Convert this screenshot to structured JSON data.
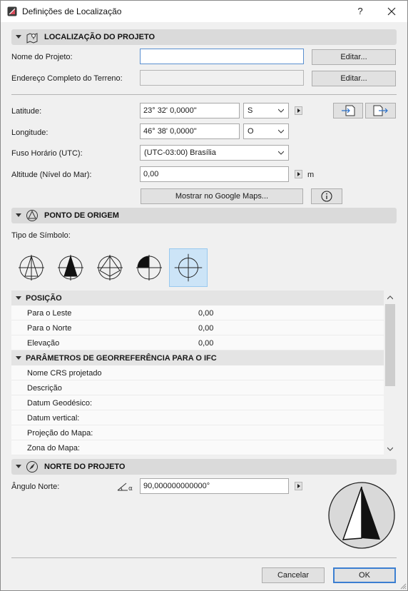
{
  "window": {
    "title": "Definições de Localização",
    "help_label": "?"
  },
  "project_location": {
    "header": "LOCALIZAÇÃO DO PROJETO",
    "project_name_label": "Nome do Projeto:",
    "project_name_value": "",
    "address_label": "Endereço Completo do Terreno:",
    "address_value": "",
    "edit_label": "Editar...",
    "latitude_label": "Latitude:",
    "latitude_value": "23° 32' 0,0000\"",
    "latitude_hemisphere": "S",
    "longitude_label": "Longitude:",
    "longitude_value": "46° 38' 0,0000\"",
    "longitude_hemisphere": "O",
    "timezone_label": "Fuso Horário (UTC):",
    "timezone_value": "(UTC-03:00) Brasília",
    "altitude_label": "Altitude (Nível do Mar):",
    "altitude_value": "0,00",
    "altitude_unit": "m",
    "google_maps_label": "Mostrar no Google Maps..."
  },
  "origin_point": {
    "header": "PONTO DE ORIGEM",
    "symbol_type_label": "Tipo de Símbolo:",
    "symbols": [
      "symbol-1",
      "symbol-2",
      "symbol-3",
      "symbol-4",
      "symbol-5"
    ],
    "selected_symbol": 5
  },
  "tree": {
    "position_header": "POSIÇÃO",
    "position_rows": [
      {
        "key": "Para o Leste",
        "value": "0,00"
      },
      {
        "key": "Para o Norte",
        "value": "0,00"
      },
      {
        "key": "Elevação",
        "value": "0,00"
      }
    ],
    "ifc_header": "PARÂMETROS DE GEORREFERÊNCIA PARA O IFC",
    "ifc_rows": [
      {
        "key": "Nome CRS projetado",
        "value": ""
      },
      {
        "key": "Descrição",
        "value": ""
      },
      {
        "key": "Datum Geodésico:",
        "value": ""
      },
      {
        "key": "Datum vertical:",
        "value": ""
      },
      {
        "key": "Projeção do Mapa:",
        "value": ""
      },
      {
        "key": "Zona do Mapa:",
        "value": ""
      }
    ]
  },
  "project_north": {
    "header": "NORTE DO PROJETO",
    "angle_label": "Ângulo Norte:",
    "angle_value": "90,000000000000°"
  },
  "footer": {
    "cancel_label": "Cancelar",
    "ok_label": "OK"
  },
  "colors": {
    "accent": "#3c7fd1",
    "section_header": "#dadada",
    "selected_symbol_bg": "#cce4f7"
  }
}
